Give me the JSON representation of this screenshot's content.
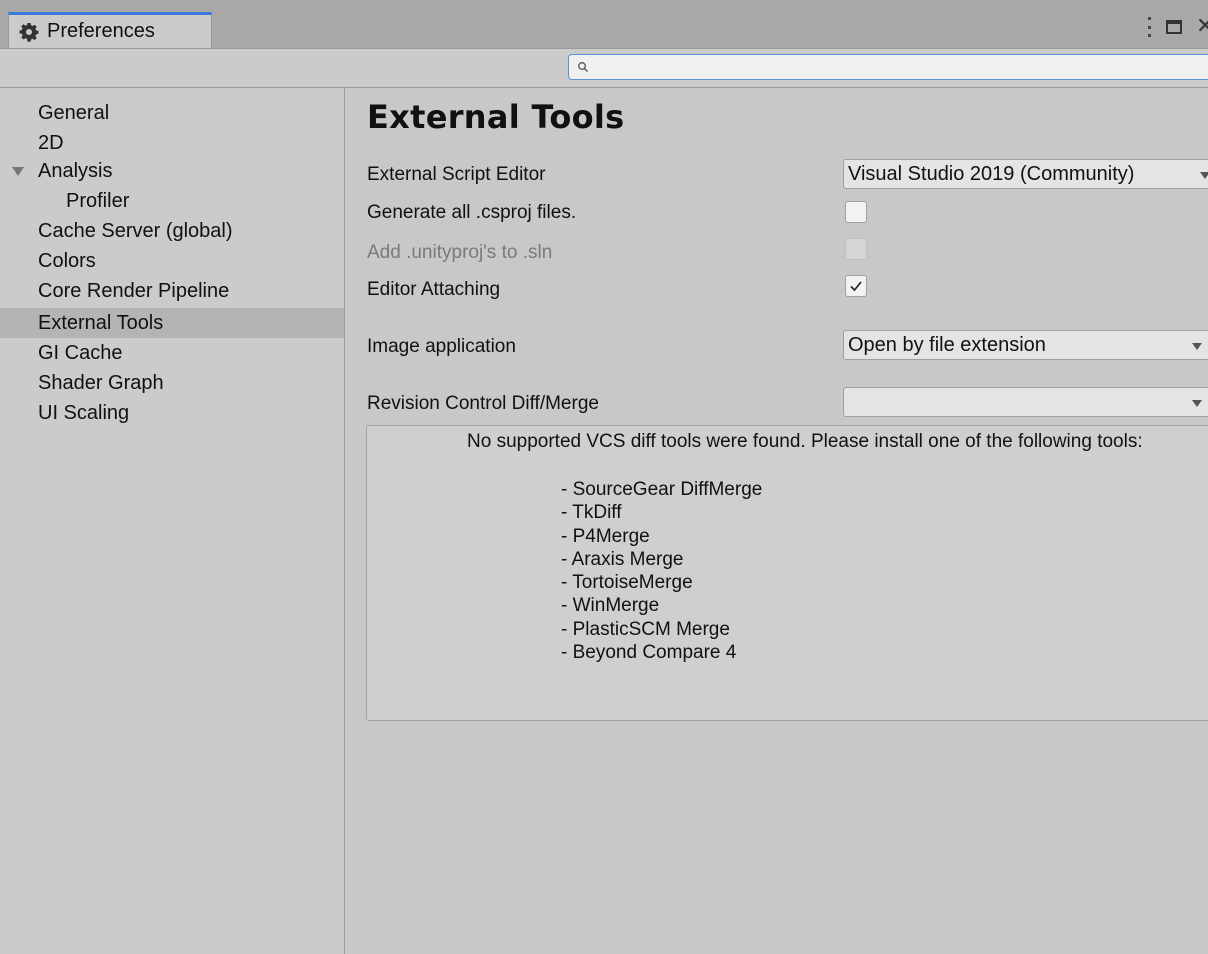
{
  "window": {
    "tab_title": "Preferences"
  },
  "search": {
    "value": "",
    "placeholder": ""
  },
  "sidebar": {
    "items": [
      {
        "label": "General"
      },
      {
        "label": "2D"
      },
      {
        "label": "Analysis"
      },
      {
        "label": "Profiler"
      },
      {
        "label": "Cache Server (global)"
      },
      {
        "label": "Colors"
      },
      {
        "label": "Core Render Pipeline"
      },
      {
        "label": "External Tools"
      },
      {
        "label": "GI Cache"
      },
      {
        "label": "Shader Graph"
      },
      {
        "label": "UI Scaling"
      }
    ],
    "selected": "External Tools"
  },
  "main": {
    "title": "External Tools",
    "external_script_editor": {
      "label": "External Script Editor",
      "value": "Visual Studio 2019 (Community)"
    },
    "generate_csproj": {
      "label": "Generate all .csproj files.",
      "checked": false
    },
    "add_unityproj": {
      "label": "Add .unityproj's to .sln",
      "checked": false,
      "enabled": false
    },
    "editor_attaching": {
      "label": "Editor Attaching",
      "checked": true
    },
    "image_application": {
      "label": "Image application",
      "value": "Open by file extension"
    },
    "revision_control": {
      "label": "Revision Control Diff/Merge",
      "value": ""
    },
    "vcs_message": {
      "text": "No supported VCS diff tools were found. Please install one of the following tools:",
      "tools": [
        "- SourceGear DiffMerge",
        "- TkDiff",
        "- P4Merge",
        "- Araxis Merge",
        "- TortoiseMerge",
        "- WinMerge",
        "- PlasticSCM Merge",
        "- Beyond Compare 4"
      ]
    }
  },
  "colors": {
    "accent": "#3a79d9",
    "selected_row": "#b4b4b4",
    "panel_bg": "#c8c8c8"
  }
}
